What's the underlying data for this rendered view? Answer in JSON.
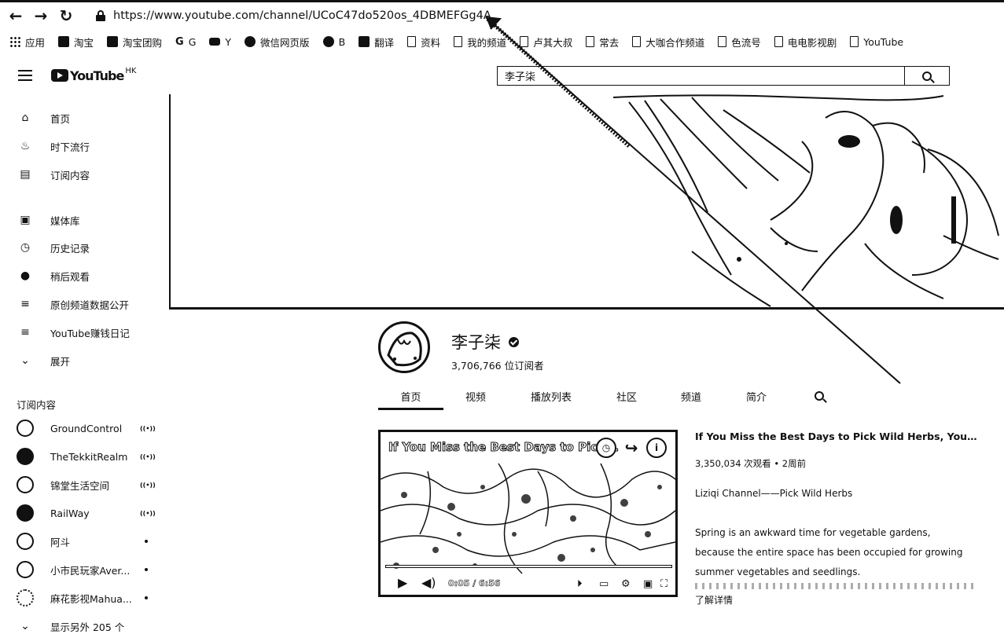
{
  "browser": {
    "url": "https://www.youtube.com/channel/UCoC47do520os_4DBMEFGg4A"
  },
  "bookmarks": [
    {
      "label": "应用",
      "icon": "apps-icon"
    },
    {
      "label": "淘宝",
      "icon": "taobao-icon"
    },
    {
      "label": "淘宝团购",
      "icon": "taobao-group-icon"
    },
    {
      "label": "G",
      "icon": "google-icon"
    },
    {
      "label": "Y",
      "icon": "youtube-icon"
    },
    {
      "label": "微信网页版",
      "icon": "wechat-icon"
    },
    {
      "label": "B",
      "icon": "baidu-icon"
    },
    {
      "label": "翻译",
      "icon": "translate-icon"
    },
    {
      "label": "资料",
      "icon": "folder-icon"
    },
    {
      "label": "我的频道",
      "icon": "folder-icon"
    },
    {
      "label": "卢其大叔",
      "icon": "folder-icon"
    },
    {
      "label": "常去",
      "icon": "folder-icon"
    },
    {
      "label": "大咖合作频道",
      "icon": "folder-icon"
    },
    {
      "label": "色流号",
      "icon": "folder-icon"
    },
    {
      "label": "电电影视剧",
      "icon": "folder-icon"
    },
    {
      "label": "YouTube",
      "icon": "folder-icon"
    }
  ],
  "logo": {
    "text": "YouTube",
    "region": "HK"
  },
  "search": {
    "value": "李子柒"
  },
  "sidebar": {
    "main": [
      {
        "label": "首页",
        "icon": "home-icon"
      },
      {
        "label": "时下流行",
        "icon": "trending-icon"
      },
      {
        "label": "订阅内容",
        "icon": "subscriptions-icon"
      }
    ],
    "library": [
      {
        "label": "媒体库",
        "icon": "library-icon"
      },
      {
        "label": "历史记录",
        "icon": "history-icon"
      },
      {
        "label": "稍后观看",
        "icon": "watch-later-icon"
      },
      {
        "label": "原创频道数据公开",
        "icon": "playlist-icon"
      },
      {
        "label": "YouTube赚钱日记",
        "icon": "playlist-icon"
      },
      {
        "label": "展开",
        "icon": "chevron-down-icon"
      }
    ],
    "subscriptions_title": "订阅内容",
    "subscriptions": [
      {
        "label": "GroundControl",
        "status": "live"
      },
      {
        "label": "TheTekkitRealm",
        "status": "live"
      },
      {
        "label": "锦堂生活空间",
        "status": "live"
      },
      {
        "label": "RailWay",
        "status": "live"
      },
      {
        "label": "阿斗",
        "status": "new"
      },
      {
        "label": "小市民玩家Aver...",
        "status": "new"
      },
      {
        "label": "麻花影视Mahua...",
        "status": "new"
      }
    ],
    "show_more": "显示另外 205 个"
  },
  "channel": {
    "name": "李子柒",
    "subscribers": "3,706,766 位订阅者",
    "tabs": [
      "首页",
      "视频",
      "播放列表",
      "社区",
      "频道",
      "简介"
    ],
    "active_tab": 0
  },
  "video": {
    "overlay_title": "If You Miss the Best Days to Pick...",
    "time": "0:05 / 6:56",
    "title": "If You Miss the Best Days to Pick Wild Herbs, You've Missed t...",
    "meta": "3,350,034 次观看 • 2周前",
    "desc_lines": [
      "Liziqi Channel——Pick Wild Herbs",
      "",
      "Spring is an awkward time for vegetable gardens,",
      "because the entire space has been occupied for growing",
      "summer vegetables and seedlings."
    ],
    "more": "了解详情"
  }
}
